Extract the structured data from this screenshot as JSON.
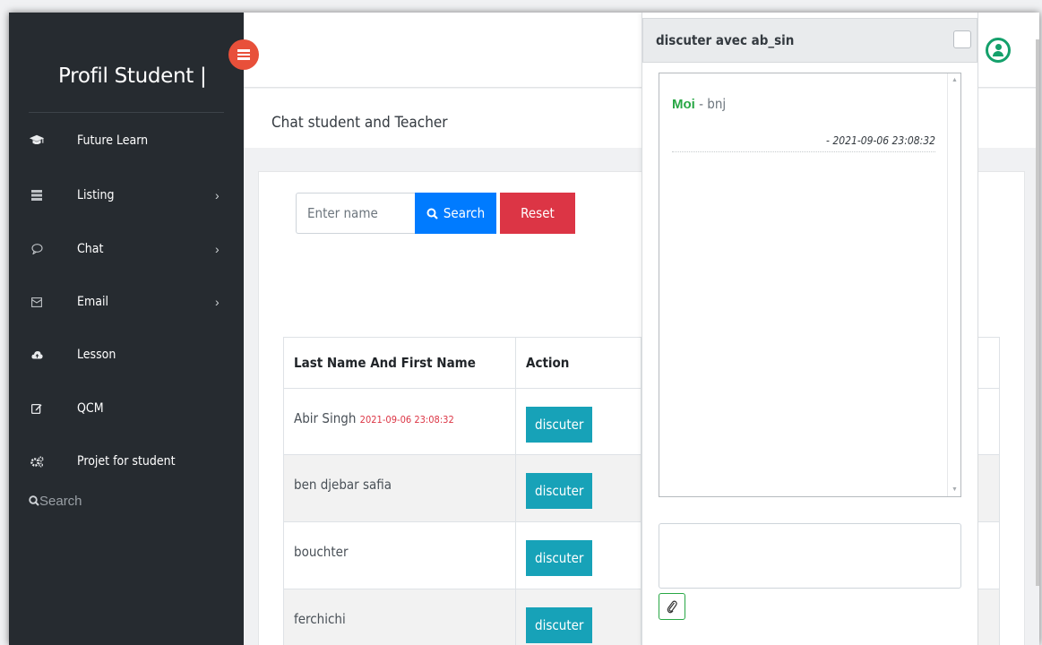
{
  "sidebar": {
    "brand": "Profil Student |",
    "items": [
      {
        "label": "Future Learn",
        "icon": "graduation-cap-icon",
        "has_submenu": false
      },
      {
        "label": "Listing",
        "icon": "server-icon",
        "has_submenu": true
      },
      {
        "label": "Chat",
        "icon": "chat-bubble-icon",
        "has_submenu": true
      },
      {
        "label": "Email",
        "icon": "envelope-icon",
        "has_submenu": true
      },
      {
        "label": "Lesson",
        "icon": "cloud-upload-icon",
        "has_submenu": false
      },
      {
        "label": "QCM",
        "icon": "edit-icon",
        "has_submenu": false
      },
      {
        "label": "Projet for student",
        "icon": "cogs-icon",
        "has_submenu": false
      }
    ],
    "search_label": "Search",
    "chevron": "›"
  },
  "page": {
    "title": "Chat student and Teacher"
  },
  "search": {
    "placeholder": "Enter name",
    "search_label": "Search",
    "reset_label": "Reset"
  },
  "table": {
    "headers": [
      "Last Name And First Name",
      "Action"
    ],
    "rows": [
      {
        "name": "Abir Singh",
        "timestamp": "2021-09-06 23:08:32",
        "action": "discuter"
      },
      {
        "name": "ben djebar safia",
        "timestamp": "",
        "action": "discuter"
      },
      {
        "name": "bouchter",
        "timestamp": "",
        "action": "discuter"
      },
      {
        "name": "ferchichi",
        "timestamp": "",
        "action": "discuter"
      }
    ]
  },
  "chat": {
    "title": "discuter avec ab_sin",
    "messages": [
      {
        "sender": "Moi",
        "separator": " - ",
        "text": "bnj",
        "time": "- 2021-09-06 23:08:32"
      }
    ],
    "compose_value": "",
    "attach_icon": "paperclip-icon"
  },
  "colors": {
    "sidebar_bg": "#262b30",
    "toggle": "#e8503a",
    "primary": "#007bff",
    "danger": "#dc3545",
    "info": "#17a2b8",
    "success": "#28a745"
  }
}
